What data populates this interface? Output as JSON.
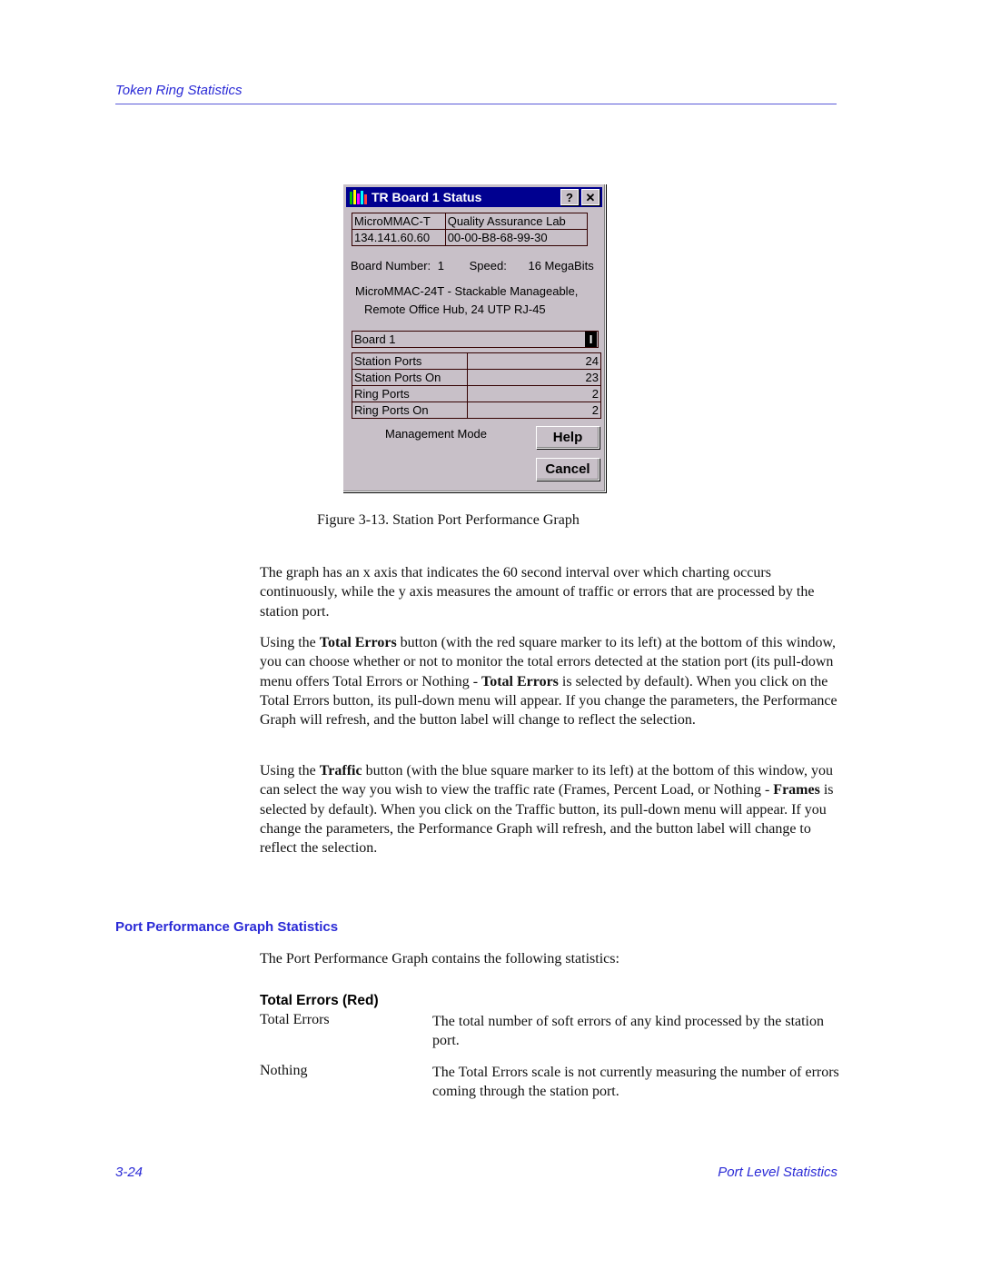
{
  "header": {
    "running_title": "Token Ring Statistics"
  },
  "dialog": {
    "title": "TR Board 1 Status",
    "help_glyph": "?",
    "close_glyph": "✕",
    "info": {
      "device_name": "MicroMMAC-T",
      "location": "Quality Assurance Lab",
      "ip_address": "134.141.60.60",
      "mac_address": "00-00-B8-68-99-30"
    },
    "board_number_label": "Board Number:",
    "board_number_value": "1",
    "speed_label": "Speed:",
    "speed_value": "16 MegaBits",
    "description_line1": "MicroMMAC-24T - Stackable Manageable,",
    "description_line2": "Remote Office Hub, 24 UTP RJ-45",
    "board_select_value": "Board 1",
    "cursor_glyph": "I",
    "stats": [
      {
        "label": "Station Ports",
        "value": "24"
      },
      {
        "label": "Station Ports On",
        "value": "23"
      },
      {
        "label": "Ring Ports",
        "value": "2"
      },
      {
        "label": "Ring Ports On",
        "value": "2"
      }
    ],
    "management_mode_label": "Management Mode",
    "help_button": "Help",
    "cancel_button": "Cancel"
  },
  "figure_caption": "Figure 3-13.  Station Port Performance Graph",
  "paragraphs": {
    "p1": "The graph has an x axis that indicates the 60 second interval over which charting occurs continuously, while the y axis measures the amount of traffic or errors that are processed by the station port.",
    "p2_a": "Using the ",
    "p2_b1": "Total Errors",
    "p2_c": " button (with the red square marker to its left) at the bottom of this window, you can choose whether or not to monitor the total errors detected at the station port (its pull-down menu offers Total Errors or Nothing - ",
    "p2_b2": "Total Errors",
    "p2_d": " is selected by default). When you click on the Total Errors button, its pull-down menu will appear. If you change the parameters, the Performance Graph will refresh, and the button label will change to reflect the selection.",
    "p3_a": "Using the ",
    "p3_b1": "Traffic",
    "p3_c": " button (with the blue square marker to its left) at the bottom of this window, you can select the way you wish to view the traffic rate (Frames, Percent Load, or Nothing - ",
    "p3_b2": "Frames",
    "p3_d": " is selected by default). When you click on the Traffic button, its pull-down menu will appear. If you change the parameters, the Performance Graph will refresh, and the button label will change to reflect the selection."
  },
  "section": {
    "heading": "Port Performance Graph Statistics",
    "intro": "The Port Performance Graph contains the following statistics:",
    "subheading": "Total Errors (Red)",
    "definitions": [
      {
        "term": "Total Errors",
        "description": "The total number of soft errors of any kind processed by the station port."
      },
      {
        "term": "Nothing",
        "description": "The Total Errors scale is not currently measuring the number of errors coming through the station port."
      }
    ]
  },
  "footer": {
    "page_number": "3-24",
    "chapter_title": "Port Level Statistics"
  }
}
